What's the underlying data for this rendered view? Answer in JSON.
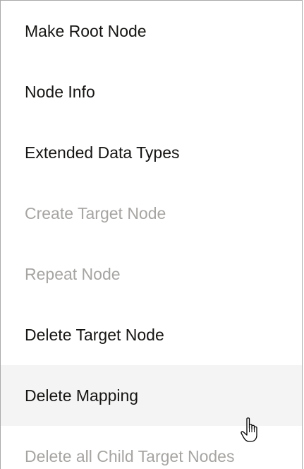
{
  "menu": {
    "items": [
      {
        "label": "Make Root Node",
        "state": "enabled"
      },
      {
        "label": "Node Info",
        "state": "enabled"
      },
      {
        "label": "Extended Data Types",
        "state": "enabled"
      },
      {
        "label": "Create Target Node",
        "state": "disabled"
      },
      {
        "label": "Repeat Node",
        "state": "disabled"
      },
      {
        "label": "Delete Target Node",
        "state": "enabled"
      },
      {
        "label": "Delete Mapping",
        "state": "hovered"
      },
      {
        "label": "Delete all Child Target Nodes",
        "state": "disabled"
      }
    ]
  },
  "colors": {
    "text": "#161513",
    "disabled_text": "#a7a5a2",
    "hover_background": "#f4f4f4",
    "border": "#a9a9a9"
  },
  "cursor": {
    "icon": "hand-pointer-icon"
  }
}
